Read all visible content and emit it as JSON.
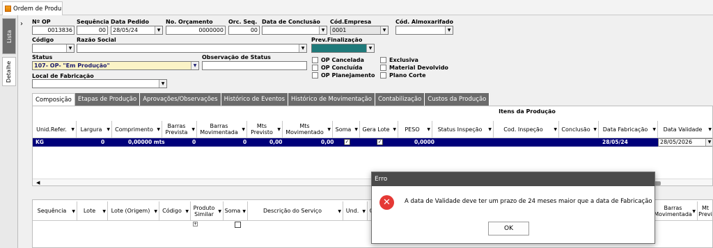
{
  "window": {
    "tab_title": "Ordem de Produ…"
  },
  "side_tabs": {
    "lista": "Lista",
    "detalhe": "Detalhe"
  },
  "form": {
    "nro_op": {
      "label": "Nº OP",
      "value": "0013836"
    },
    "sequencia": {
      "label": "Sequência",
      "value": "00"
    },
    "data_pedido": {
      "label": "Data Pedido",
      "value": "28/05/24"
    },
    "no_orcamento": {
      "label": "No. Orçamento",
      "value": "0000000"
    },
    "orc_seq": {
      "label": "Orc. Seq.",
      "value": "00"
    },
    "data_conclusao": {
      "label": "Data de Conclusão",
      "value": ""
    },
    "cod_empresa": {
      "label": "Cód.Empresa",
      "value": "0001"
    },
    "cod_almoxarifado": {
      "label": "Cód. Almoxarifado",
      "value": ""
    },
    "codigo": {
      "label": "Código",
      "value": ""
    },
    "razao_social": {
      "label": "Razão Social",
      "value": ""
    },
    "prev_finalizacao": {
      "label": "Prev.Finalização",
      "value": ""
    },
    "status": {
      "label": "Status",
      "value": "107- OP- \"Em Produção\""
    },
    "obs_status": {
      "label": "Observação de Status",
      "value": ""
    },
    "local_fabricacao": {
      "label": "Local de Fabricação",
      "value": ""
    },
    "checks": [
      "OP Cancelada",
      "OP Concluída",
      "OP Planejamento",
      "Exclusiva",
      "Material Devolvido",
      "Plano Corte"
    ]
  },
  "tabs": [
    "Composição",
    "Etapas de Produção",
    "Aprovações/Observações",
    "Histórico de Eventos",
    "Histórico de Movimentação",
    "Contabilização",
    "Custos da Produção"
  ],
  "grid1": {
    "title": "Itens da Produção",
    "headers": [
      "Unid.Refer.",
      "Largura",
      "Comprimento",
      "Barras Prevista",
      "Barras Movimentada",
      "Mts Previsto",
      "Mts Movimentado",
      "Soma",
      "Gera Lote",
      "PESO",
      "Status Inspeção",
      "Cod. Inspeção",
      "Conclusão",
      "Data Fabricação",
      "Data Validade"
    ],
    "row": {
      "unid": "KG",
      "largura": "0",
      "comprimento": "0,00000 mts",
      "barras_prev": "0",
      "barras_mov": "0",
      "mts_prev": "0,00",
      "mts_mov": "0,00",
      "peso": "0,0000",
      "data_fab": "28/05/24",
      "data_val": "28/05/2026"
    }
  },
  "grid2": {
    "headers": [
      "Sequência",
      "Lote",
      "Lote (Origem)",
      "Código",
      "Produto Similar",
      "Soma",
      "Descrição do Serviço",
      "Und.",
      "C",
      "Barras Movimentada",
      "Mt Previ"
    ]
  },
  "dialog": {
    "title": "Erro",
    "message": "A data de Validade deve ter um prazo de 24 meses maior que a data de Fabricação",
    "ok": "OK",
    "error_color": "#e53935"
  },
  "colors": {
    "selected_row": "#00007a",
    "status_field": "#fbf3c6",
    "prev_field": "#1f7a7a",
    "inactive_tab": "#6b6b6b"
  }
}
